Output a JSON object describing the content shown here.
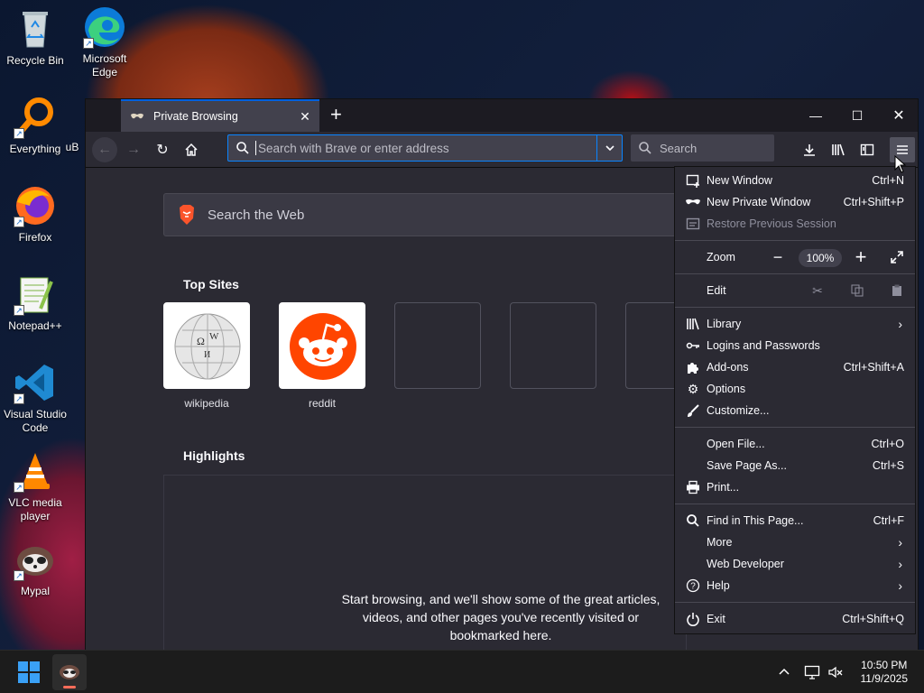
{
  "desktop": {
    "icons": [
      {
        "label": "Recycle Bin"
      },
      {
        "label": "Microsoft Edge"
      },
      {
        "label": "Everything"
      },
      {
        "label": "uB"
      },
      {
        "label": "Firefox"
      },
      {
        "label": "Notepad++"
      },
      {
        "label": "Visual Studio Code"
      },
      {
        "label": "VLC media player"
      },
      {
        "label": "Mypal"
      }
    ]
  },
  "browser": {
    "tab_title": "Private Browsing",
    "address_placeholder": "Search with Brave or enter address",
    "search_placeholder": "Search",
    "web_search_placeholder": "Search the Web",
    "top_sites_title": "Top Sites",
    "top_sites": [
      {
        "label": "wikipedia"
      },
      {
        "label": "reddit"
      },
      {
        "label": ""
      },
      {
        "label": ""
      },
      {
        "label": ""
      }
    ],
    "highlights_title": "Highlights",
    "highlights_message": "Start browsing, and we'll show some of the great articles, videos, and other pages you've recently visited or bookmarked here."
  },
  "menu": {
    "new_window": {
      "label": "New Window",
      "shortcut": "Ctrl+N"
    },
    "new_private_window": {
      "label": "New Private Window",
      "shortcut": "Ctrl+Shift+P"
    },
    "restore_session": {
      "label": "Restore Previous Session"
    },
    "zoom": {
      "label": "Zoom",
      "value": "100%"
    },
    "edit": {
      "label": "Edit"
    },
    "library": {
      "label": "Library"
    },
    "logins": {
      "label": "Logins and Passwords"
    },
    "addons": {
      "label": "Add-ons",
      "shortcut": "Ctrl+Shift+A"
    },
    "options": {
      "label": "Options"
    },
    "customize": {
      "label": "Customize..."
    },
    "open_file": {
      "label": "Open File...",
      "shortcut": "Ctrl+O"
    },
    "save_page": {
      "label": "Save Page As...",
      "shortcut": "Ctrl+S"
    },
    "print": {
      "label": "Print..."
    },
    "find": {
      "label": "Find in This Page...",
      "shortcut": "Ctrl+F"
    },
    "more": {
      "label": "More"
    },
    "web_developer": {
      "label": "Web Developer"
    },
    "help": {
      "label": "Help"
    },
    "exit": {
      "label": "Exit",
      "shortcut": "Ctrl+Shift+Q"
    }
  },
  "taskbar": {
    "time": "10:50 PM",
    "date": "11/9/2025"
  },
  "colors": {
    "accent": "#0a84ff",
    "menu_bg": "#2b2a33",
    "reddit": "#ff4500",
    "brave": "#fb542b"
  }
}
